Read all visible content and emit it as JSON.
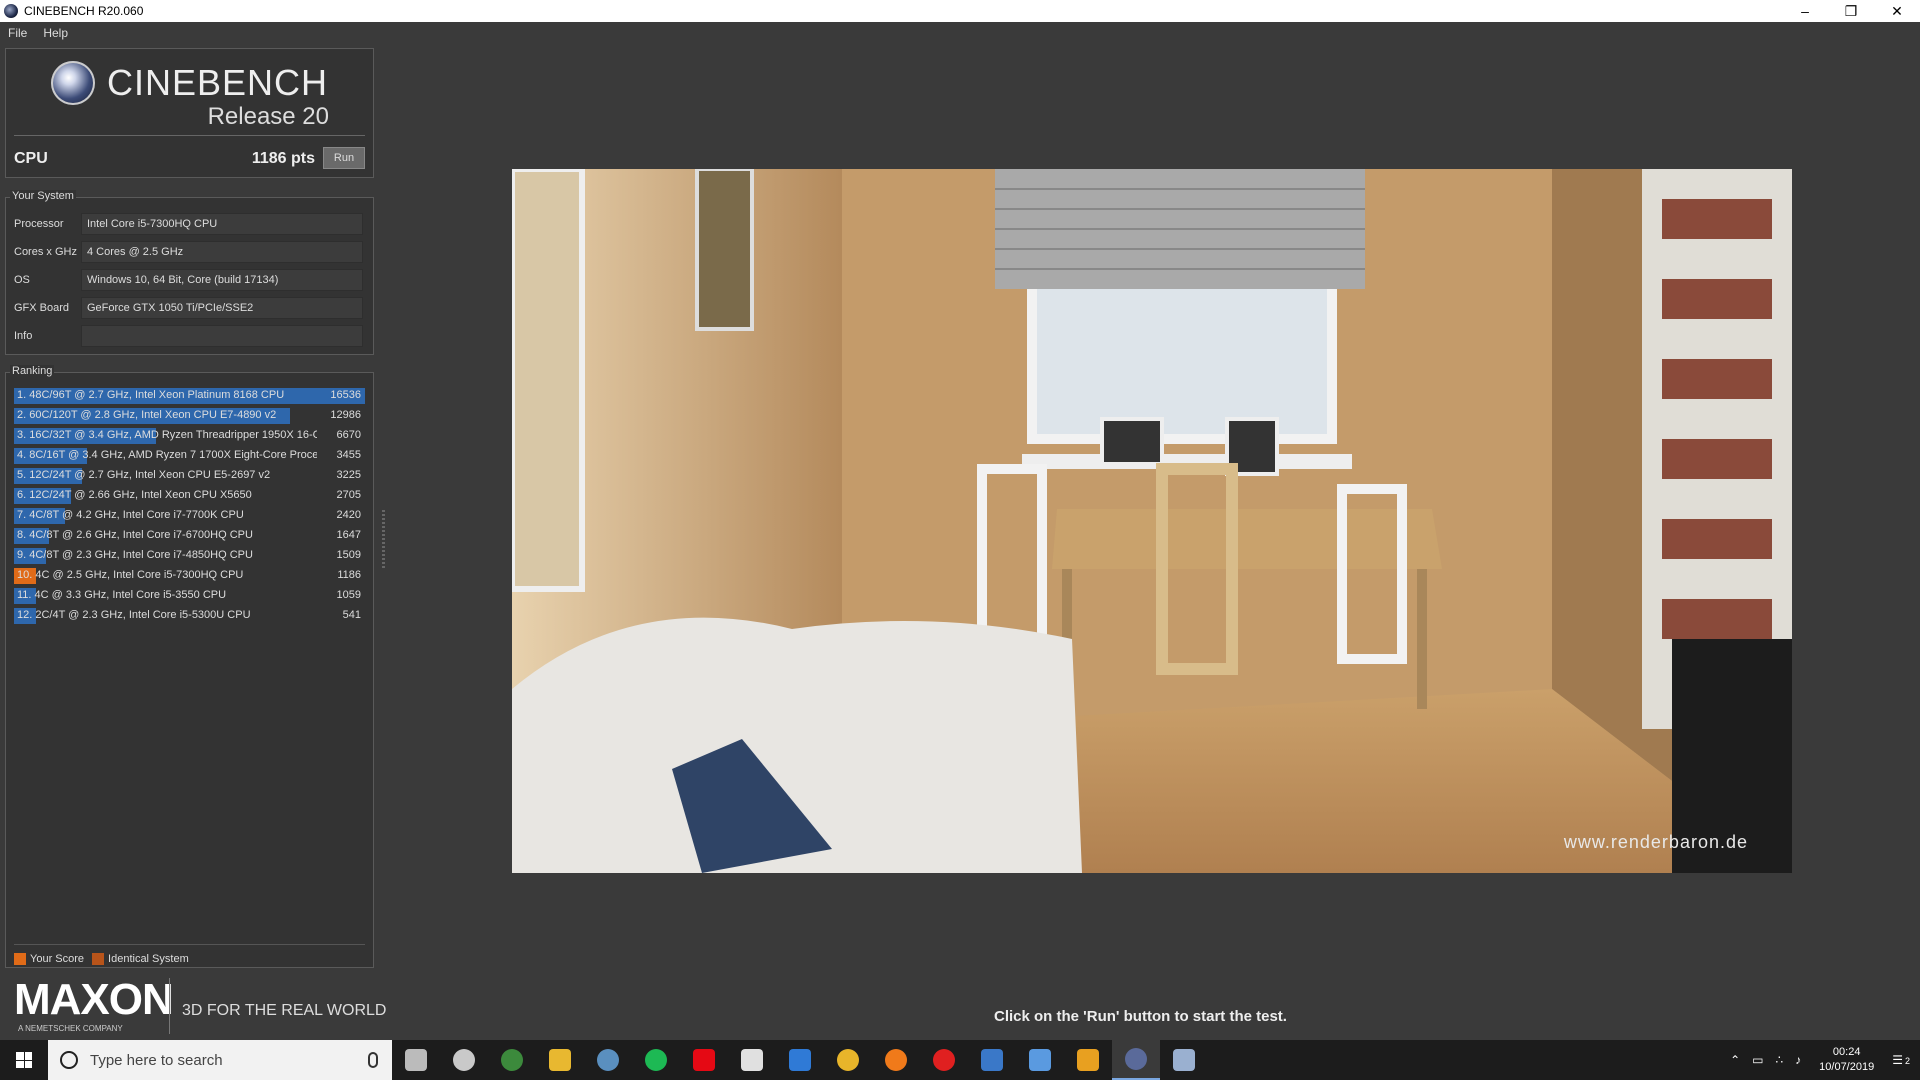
{
  "window": {
    "title": "CINEBENCH R20.060"
  },
  "menu": [
    "File",
    "Help"
  ],
  "logo": {
    "name": "CINEBENCH",
    "release": "Release 20"
  },
  "cpu": {
    "label": "CPU",
    "score": "1186 pts",
    "run_label": "Run"
  },
  "system": {
    "title": "Your System",
    "rows": [
      {
        "label": "Processor",
        "value": "Intel Core i5-7300HQ CPU"
      },
      {
        "label": "Cores x GHz",
        "value": "4 Cores @ 2.5 GHz"
      },
      {
        "label": "OS",
        "value": "Windows 10, 64 Bit, Core (build 17134)"
      },
      {
        "label": "GFX Board",
        "value": "GeForce GTX 1050 Ti/PCIe/SSE2"
      },
      {
        "label": "Info",
        "value": ""
      }
    ]
  },
  "ranking": {
    "title": "Ranking",
    "max_score": 16536,
    "items": [
      {
        "text": "1. 48C/96T @ 2.7 GHz, Intel Xeon Platinum 8168 CPU",
        "score": 16536,
        "score_label": "16536",
        "you": false
      },
      {
        "text": "2. 60C/120T @ 2.8 GHz, Intel Xeon CPU E7-4890 v2",
        "score": 12986,
        "score_label": "12986",
        "you": false
      },
      {
        "text": "3. 16C/32T @ 3.4 GHz, AMD Ryzen Threadripper 1950X 16-C",
        "score": 6670,
        "score_label": "6670",
        "you": false
      },
      {
        "text": "4. 8C/16T @ 3.4 GHz, AMD Ryzen 7 1700X Eight-Core Proces",
        "score": 3455,
        "score_label": "3455",
        "you": false
      },
      {
        "text": "5. 12C/24T @ 2.7 GHz, Intel Xeon CPU E5-2697 v2",
        "score": 3225,
        "score_label": "3225",
        "you": false
      },
      {
        "text": "6. 12C/24T @ 2.66 GHz, Intel Xeon CPU X5650",
        "score": 2705,
        "score_label": "2705",
        "you": false
      },
      {
        "text": "7. 4C/8T @ 4.2 GHz, Intel Core i7-7700K CPU",
        "score": 2420,
        "score_label": "2420",
        "you": false
      },
      {
        "text": "8. 4C/8T @ 2.6 GHz, Intel Core i7-6700HQ CPU",
        "score": 1647,
        "score_label": "1647",
        "you": false
      },
      {
        "text": "9. 4C/8T @ 2.3 GHz, Intel Core i7-4850HQ CPU",
        "score": 1509,
        "score_label": "1509",
        "you": false
      },
      {
        "text": "10. 4C @ 2.5 GHz, Intel Core i5-7300HQ CPU",
        "score": 1186,
        "score_label": "1186",
        "you": true
      },
      {
        "text": "11. 4C @ 3.3 GHz, Intel Core i5-3550 CPU",
        "score": 1059,
        "score_label": "1059",
        "you": false
      },
      {
        "text": "12. 2C/4T @ 2.3 GHz, Intel Core i5-5300U CPU",
        "score": 541,
        "score_label": "541",
        "you": false
      }
    ],
    "legend": {
      "your_score": "Your Score",
      "identical": "Identical System",
      "your_color": "#e06b18",
      "identical_color": "#b8541a"
    }
  },
  "brand": {
    "name": "MAXON",
    "sub": "A NEMETSCHEK COMPANY",
    "tagline": "3D FOR THE REAL WORLD"
  },
  "render": {
    "watermark": "www.renderbaron.de"
  },
  "status": "Click on the 'Run' button to start the test.",
  "taskbar": {
    "search_placeholder": "Type here to search",
    "icons": [
      "task-view-icon",
      "browser-icon",
      "xbox-icon",
      "file-explorer-icon",
      "steam-icon",
      "spotify-icon",
      "netflix-icon",
      "calendar-icon",
      "edge-icon",
      "chrome-icon",
      "firefox-icon",
      "opera-icon",
      "mail-icon",
      "store-icon",
      "app-icon",
      "cinebench-icon",
      "app-icon-2"
    ],
    "icon_colors": [
      "#bbbbbb",
      "#c9c9c9",
      "#3c8a3c",
      "#e8b830",
      "#5a8fbf",
      "#1db954",
      "#e50914",
      "#e0e0e0",
      "#2f7ad6",
      "#e8b52a",
      "#f07a1a",
      "#e02020",
      "#3a78c8",
      "#5a9ae0",
      "#e8a020",
      "#5a6a9a",
      "#9ab0d0"
    ],
    "clock_time": "00:24",
    "clock_date": "10/07/2019",
    "notification_count": "2"
  }
}
